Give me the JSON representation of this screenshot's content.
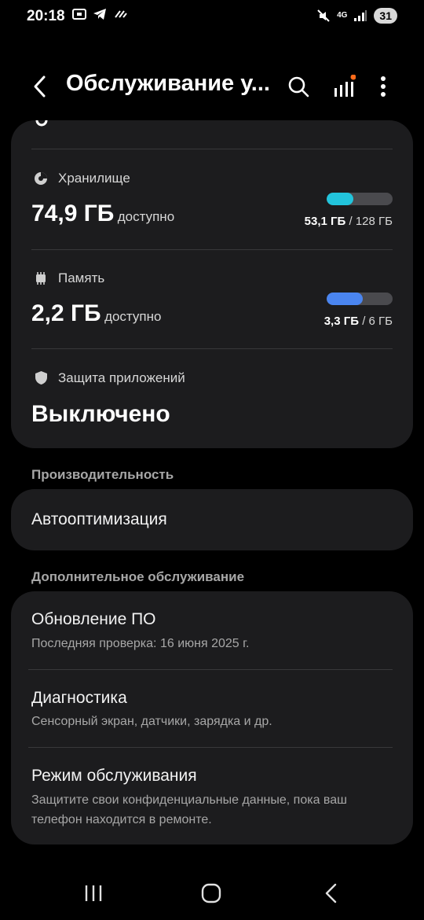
{
  "status": {
    "time": "20:18",
    "network": "4G",
    "battery": "31"
  },
  "header": {
    "title": "Обслуживание у..."
  },
  "storage": {
    "label": "Хранилище",
    "value": "74,9 ГБ",
    "avail": "доступно",
    "used": "53,1 ГБ",
    "total": "/ 128 ГБ",
    "fill_fraction": 0.41,
    "color": "#22c4dc"
  },
  "memory": {
    "label": "Память",
    "value": "2,2 ГБ",
    "avail": "доступно",
    "used": "3,3 ГБ",
    "total": "/ 6 ГБ",
    "fill_fraction": 0.55,
    "color": "#4a85f0"
  },
  "app_protection": {
    "label": "Защита приложений",
    "value": "Выключено"
  },
  "performance": {
    "section": "Производительность",
    "auto_opt": "Автооптимизация"
  },
  "extra": {
    "section": "Дополнительное обслуживание",
    "items": [
      {
        "title": "Обновление ПО",
        "sub": "Последняя проверка: 16 июня 2025 г."
      },
      {
        "title": "Диагностика",
        "sub": "Сенсорный экран, датчики, зарядка и др."
      },
      {
        "title": "Режим обслуживания",
        "sub": "Защитите свои конфиденциальные данные, пока ваш телефон находится в ремонте."
      }
    ]
  },
  "colors": {
    "background": "#000000",
    "card": "#1c1c1e",
    "notification_dot": "#ff6b1a"
  }
}
